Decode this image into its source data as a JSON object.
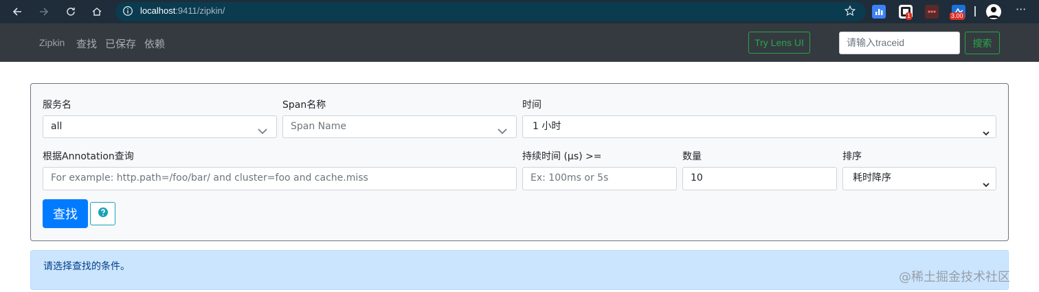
{
  "browser": {
    "url_host": "localhost",
    "url_port": ":9411/zipkin/",
    "ext_badge_1": "1",
    "ext_badge_2": "3.00"
  },
  "navbar": {
    "brand": "Zipkin",
    "links": [
      "查找",
      "已保存",
      "依赖"
    ],
    "lens_button": "Try Lens UI",
    "traceid_placeholder": "请输入traceid",
    "search_button": "搜索"
  },
  "form": {
    "service_label": "服务名",
    "service_value": "all",
    "span_label": "Span名称",
    "span_placeholder": "Span Name",
    "time_label": "时间",
    "time_value": "1 小时",
    "annotation_label": "根据Annotation查询",
    "annotation_placeholder": "For example: http.path=/foo/bar/ and cluster=foo and cache.miss",
    "duration_label": "持续时间 (μs) >=",
    "duration_placeholder": "Ex: 100ms or 5s",
    "limit_label": "数量",
    "limit_value": "10",
    "sort_label": "排序",
    "sort_value": "耗时降序",
    "find_button": "查找"
  },
  "alert": {
    "message": "请选择查找的条件。"
  },
  "watermark": "@稀土掘金技术社区",
  "colors": {
    "navbar": "#343a40",
    "primary": "#007bff",
    "success": "#28a745",
    "info": "#17a2b8",
    "alert_bg": "#cce5ff"
  }
}
